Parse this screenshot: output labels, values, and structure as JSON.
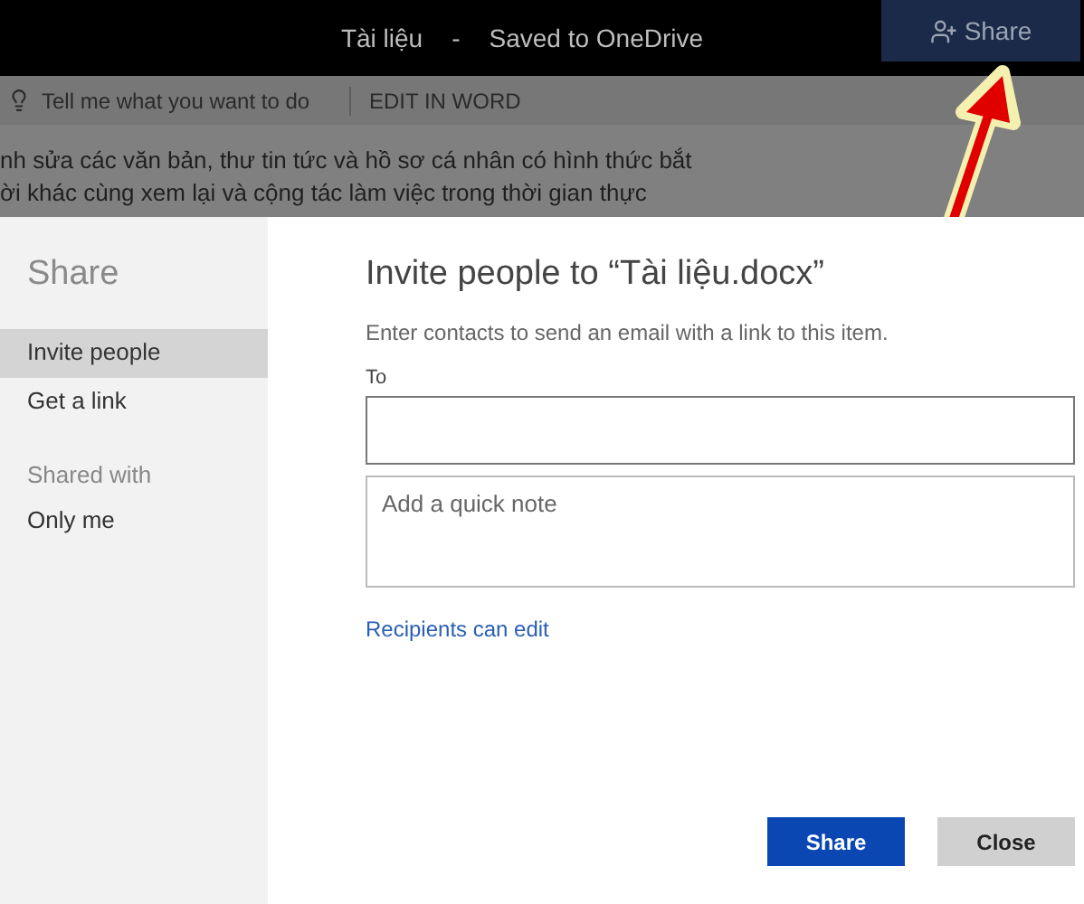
{
  "title_bar": {
    "document": "Tài liệu",
    "separator": "-",
    "status": "Saved to OneDrive",
    "share_button": "Share"
  },
  "toolbar": {
    "tell_me": "Tell me what you want to do",
    "edit_in_word": "EDIT IN WORD"
  },
  "document_lines": [
    "nh sửa các văn bản, thư tin tức và hồ sơ cá nhân có hình thức bắt",
    "ời khác cùng xem lại và cộng tác làm việc trong thời gian thực"
  ],
  "dialog": {
    "sidebar": {
      "title": "Share",
      "items": [
        {
          "label": "Invite people",
          "selected": true
        },
        {
          "label": "Get a link",
          "selected": false
        }
      ],
      "shared_with_label": "Shared with",
      "shared_with_value": "Only me"
    },
    "heading": "Invite people to “Tài liệu.docx”",
    "description": "Enter contacts to send an email with a link to this item.",
    "to_label": "To",
    "note_placeholder": "Add a quick note",
    "permission_link": "Recipients can edit",
    "buttons": [
      {
        "label": "Share",
        "kind": "primary"
      },
      {
        "label": "Close",
        "kind": "secondary"
      }
    ]
  }
}
